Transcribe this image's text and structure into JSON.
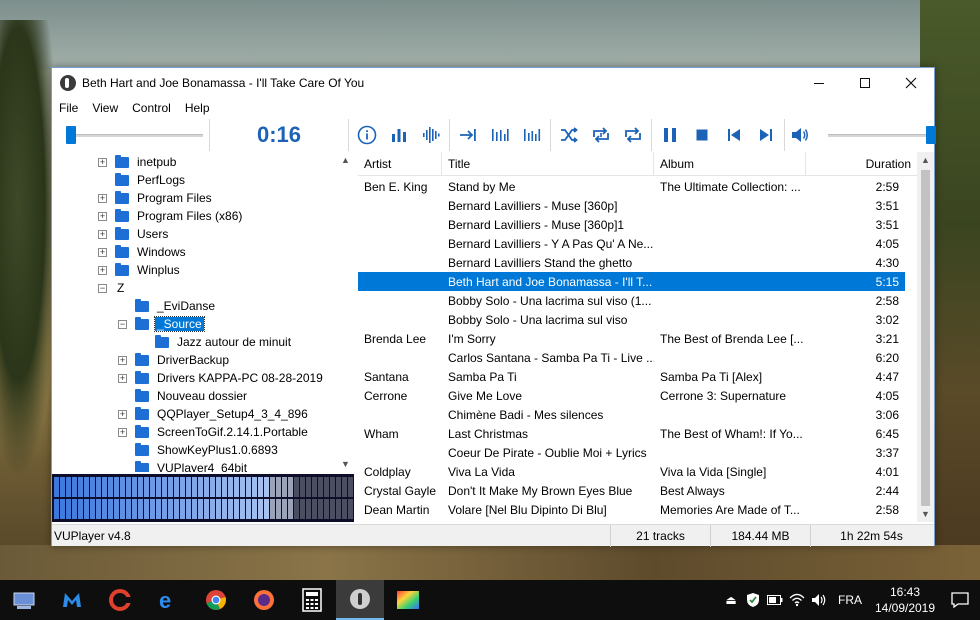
{
  "window": {
    "title": "Beth Hart and Joe Bonamassa - I'll Take Care Of You"
  },
  "menu": [
    "File",
    "View",
    "Control",
    "Help"
  ],
  "toolbar": {
    "time": "0:16",
    "position_fraction": 0.03,
    "volume_fraction": 1.0,
    "buttons": [
      "info-icon",
      "equalizer-icon",
      "waveform-icon",
      "skip-to-end-icon",
      "spectrum-icon",
      "peak-meter-icon",
      "shuffle-icon",
      "repeat-one-icon",
      "repeat-icon",
      "pause-icon",
      "stop-icon",
      "previous-icon",
      "next-icon",
      "volume-icon"
    ]
  },
  "tree": {
    "items": [
      {
        "label": "inetpub",
        "expander": "+"
      },
      {
        "label": "PerfLogs",
        "expander": ""
      },
      {
        "label": "Program Files",
        "expander": "+"
      },
      {
        "label": "Program Files (x86)",
        "expander": "+"
      },
      {
        "label": "Users",
        "expander": "+"
      },
      {
        "label": "Windows",
        "expander": "+"
      },
      {
        "label": "Winplus",
        "expander": "+"
      },
      {
        "label": "Z",
        "expander": "−",
        "nofolder": true
      },
      {
        "label": "_EviDanse",
        "expander": "",
        "level": 1
      },
      {
        "label": "_Source",
        "expander": "−",
        "level": 1,
        "selected": true
      },
      {
        "label": "Jazz autour de minuit",
        "expander": "",
        "level": 2
      },
      {
        "label": "DriverBackup",
        "expander": "+",
        "level": 1
      },
      {
        "label": "Drivers KAPPA-PC 08-28-2019",
        "expander": "+",
        "level": 1
      },
      {
        "label": "Nouveau dossier",
        "expander": "",
        "level": 1
      },
      {
        "label": "QQPlayer_Setup4_3_4_896",
        "expander": "+",
        "level": 1
      },
      {
        "label": "ScreenToGif.2.14.1.Portable",
        "expander": "+",
        "level": 1
      },
      {
        "label": "ShowKeyPlus1.0.6893",
        "expander": "",
        "level": 1
      },
      {
        "label": "VUPlayer4_64bit",
        "expander": "",
        "level": 1
      }
    ]
  },
  "playlist": {
    "columns": [
      "Artist",
      "Title",
      "Album",
      "Duration"
    ],
    "rows": [
      {
        "artist": "Ben E. King",
        "title": "Stand by Me",
        "album": "The Ultimate Collection: ...",
        "duration": "2:59"
      },
      {
        "artist": "",
        "title": "Bernard Lavilliers - Muse [360p]",
        "album": "",
        "duration": "3:51"
      },
      {
        "artist": "",
        "title": "Bernard Lavilliers - Muse [360p]1",
        "album": "",
        "duration": "3:51"
      },
      {
        "artist": "",
        "title": "Bernard Lavilliers - Y A Pas Qu' A Ne...",
        "album": "",
        "duration": "4:05"
      },
      {
        "artist": "",
        "title": "Bernard Lavilliers Stand the ghetto",
        "album": "",
        "duration": "4:30"
      },
      {
        "artist": "",
        "title": "Beth Hart and Joe Bonamassa - I'll T...",
        "album": "",
        "duration": "5:15",
        "selected": true
      },
      {
        "artist": "",
        "title": "Bobby Solo - Una lacrima sul viso (1...",
        "album": "",
        "duration": "2:58"
      },
      {
        "artist": "",
        "title": "Bobby Solo - Una lacrima sul viso",
        "album": "",
        "duration": "3:02"
      },
      {
        "artist": "Brenda Lee",
        "title": "I'm Sorry",
        "album": "The Best of Brenda Lee [...",
        "duration": "3:21"
      },
      {
        "artist": "",
        "title": "Carlos Santana - Samba Pa Ti  - Live ...",
        "album": "",
        "duration": "6:20"
      },
      {
        "artist": "Santana",
        "title": "Samba Pa Ti",
        "album": "Samba Pa Ti [Alex]",
        "duration": "4:47"
      },
      {
        "artist": "Cerrone",
        "title": "Give Me Love",
        "album": "Cerrone 3: Supernature",
        "duration": "4:05"
      },
      {
        "artist": "",
        "title": "Chimène Badi - Mes silences",
        "album": "",
        "duration": "3:06"
      },
      {
        "artist": "Wham",
        "title": "Last Christmas",
        "album": "The Best of Wham!: If Yo...",
        "duration": "6:45"
      },
      {
        "artist": "",
        "title": "Coeur De Pirate - Oublie Moi + Lyrics",
        "album": "",
        "duration": "3:37"
      },
      {
        "artist": "Coldplay",
        "title": "Viva La Vida",
        "album": "Viva la Vida [Single]",
        "duration": "4:01"
      },
      {
        "artist": "Crystal Gayle",
        "title": "Don't It Make My Brown Eyes Blue",
        "album": "Best Always",
        "duration": "2:44"
      },
      {
        "artist": "Dean Martin",
        "title": "Volare [Nel Blu Dipinto Di Blu]",
        "album": "Memories Are Made of T...",
        "duration": "2:58"
      }
    ]
  },
  "status": {
    "app": "VUPlayer v4.8",
    "tracks": "21 tracks",
    "size": "184.44 MB",
    "length": "1h 22m 54s"
  },
  "taskbar": {
    "icons": [
      "network-drive-icon",
      "malwarebytes-icon",
      "ccleaner-icon",
      "edge-icon",
      "chrome-icon",
      "firefox-icon",
      "calculator-icon",
      "vuplayer-icon",
      "color-app-icon"
    ],
    "tray": {
      "language": "FRA",
      "time": "16:43",
      "date": "14/09/2019"
    }
  },
  "colors": {
    "accent": "#0078d7",
    "time_display": "#1c63b8",
    "taskbar": "#0e0e0e"
  }
}
